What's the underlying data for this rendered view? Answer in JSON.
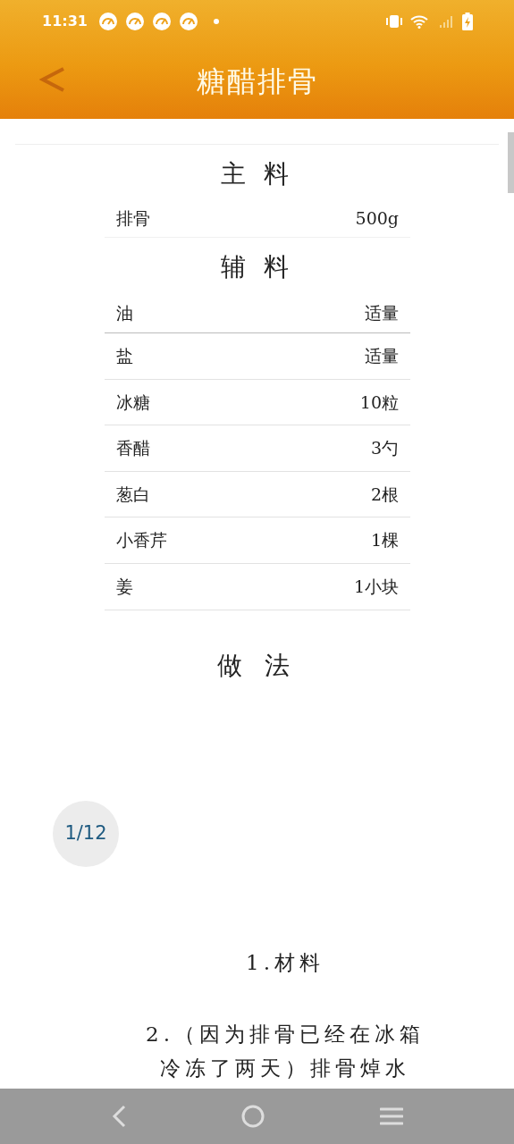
{
  "status_bar": {
    "time": "11:31"
  },
  "header": {
    "title": "糖醋排骨"
  },
  "ingredient_sections": [
    {
      "title": "主 料",
      "items": [
        {
          "name": "排骨",
          "amount": "500g"
        }
      ]
    },
    {
      "title": "辅 料",
      "items": [
        {
          "name": "油",
          "amount": "适量"
        },
        {
          "name": "盐",
          "amount": "适量"
        },
        {
          "name": "冰糖",
          "amount": "10粒"
        },
        {
          "name": "香醋",
          "amount": "3勺"
        },
        {
          "name": "葱白",
          "amount": "2根"
        },
        {
          "name": "小香芹",
          "amount": "1棵"
        },
        {
          "name": "姜",
          "amount": "1小块"
        }
      ]
    }
  ],
  "method": {
    "title": "做 法",
    "pager": "1/12",
    "steps": [
      {
        "text": "1.材料"
      },
      {
        "text": "2.（因为排骨已经在冰箱冷冻了两天）排骨焯水"
      }
    ]
  }
}
